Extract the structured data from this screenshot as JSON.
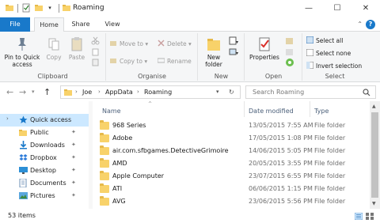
{
  "window": {
    "title": "Roaming",
    "minimize": "—",
    "maximize": "☐",
    "close": "✕"
  },
  "tabs": {
    "file": "File",
    "home": "Home",
    "share": "Share",
    "view": "View",
    "help": "?"
  },
  "ribbon": {
    "clipboard": {
      "label": "Clipboard",
      "pin": "Pin to Quick access",
      "copy": "Copy",
      "paste": "Paste"
    },
    "organise": {
      "label": "Organise",
      "move_to": "Move to ▾",
      "copy_to": "Copy to ▾",
      "delete": "Delete ▾",
      "rename": "Rename"
    },
    "new": {
      "label": "New",
      "new_folder": "New folder"
    },
    "open": {
      "label": "Open",
      "properties": "Properties"
    },
    "select": {
      "label": "Select",
      "select_all": "Select all",
      "select_none": "Select none",
      "invert": "Invert selection"
    }
  },
  "address": {
    "crumbs": [
      "Joe",
      "AppData",
      "Roaming"
    ],
    "search_placeholder": "Search Roaming"
  },
  "nav": {
    "items": [
      {
        "label": "Quick access",
        "pinned": false,
        "selected": true
      },
      {
        "label": "Public",
        "pinned": true
      },
      {
        "label": "Downloads",
        "pinned": true
      },
      {
        "label": "Dropbox",
        "pinned": true
      },
      {
        "label": "Desktop",
        "pinned": true
      },
      {
        "label": "Documents",
        "pinned": true
      },
      {
        "label": "Pictures",
        "pinned": true
      }
    ]
  },
  "list": {
    "headers": {
      "name": "Name",
      "date": "Date modified",
      "type": "Type"
    },
    "rows": [
      {
        "name": "968 Series",
        "date": "13/05/2015 7:55 AM",
        "type": "File folder"
      },
      {
        "name": "Adobe",
        "date": "17/05/2015 1:08 PM",
        "type": "File folder"
      },
      {
        "name": "air.com.sfbgames.DetectiveGrimoire",
        "date": "14/06/2015 5:05 PM",
        "type": "File folder"
      },
      {
        "name": "AMD",
        "date": "20/05/2015 3:55 PM",
        "type": "File folder"
      },
      {
        "name": "Apple Computer",
        "date": "23/07/2015 6:55 PM",
        "type": "File folder"
      },
      {
        "name": "ATI",
        "date": "06/06/2015 1:15 PM",
        "type": "File folder"
      },
      {
        "name": "AVG",
        "date": "23/06/2015 5:56 PM",
        "type": "File folder"
      }
    ]
  },
  "status": {
    "count": "53 items"
  },
  "colors": {
    "accent": "#1979ca",
    "selection": "#cce8ff",
    "folder": "#f8d26a"
  }
}
